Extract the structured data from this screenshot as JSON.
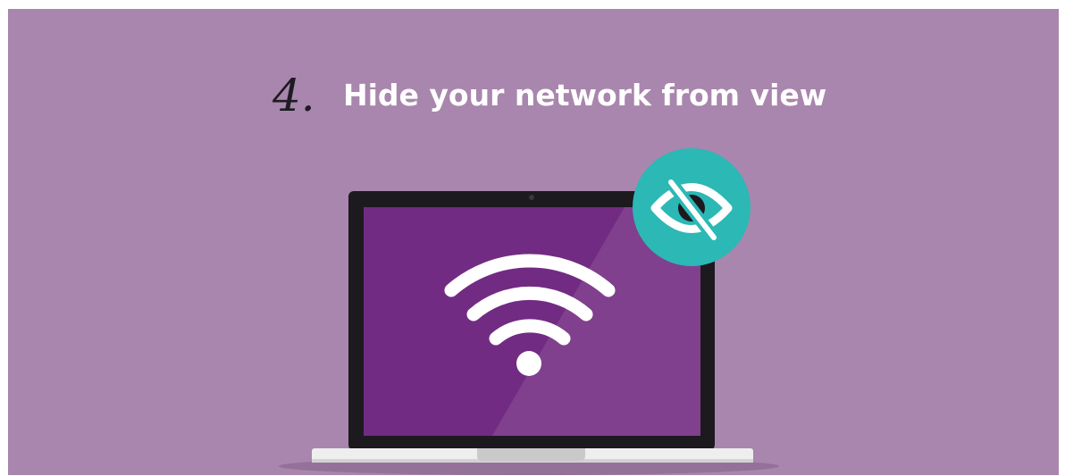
{
  "step": {
    "number": "4.",
    "title": "Hide your network from view"
  },
  "icons": {
    "screen_icon": "wifi-icon",
    "badge_icon": "eye-off-icon",
    "device": "laptop"
  },
  "colors": {
    "background": "#a986ad",
    "screen": "#722b82",
    "badge": "#2cb8b5",
    "laptop_frame": "#1c1a1f",
    "laptop_base": "#eeeeee",
    "wifi": "#ffffff"
  }
}
